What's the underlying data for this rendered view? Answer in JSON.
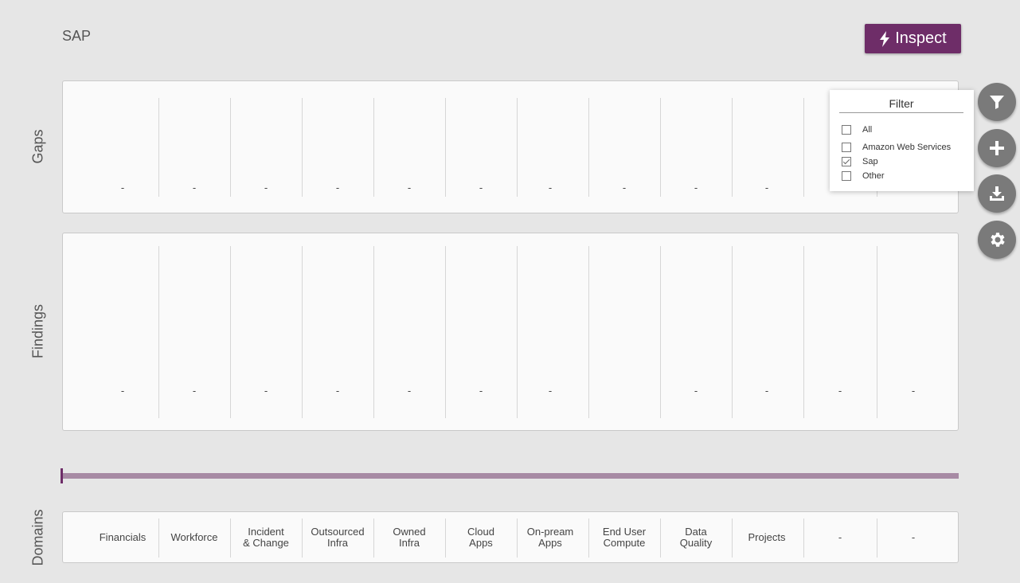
{
  "page": {
    "title": "SAP"
  },
  "toolbar": {
    "inspect_label": "Inspect",
    "inspect_icon": "bolt-icon"
  },
  "labels": {
    "gaps": "Gaps",
    "findings": "Findings",
    "domains": "Domains"
  },
  "gaps": [
    "-",
    "-",
    "-",
    "-",
    "-",
    "-",
    "-",
    "-",
    "-",
    "-"
  ],
  "findings": [
    "-",
    "-",
    "-",
    "-",
    "-",
    "-",
    "-",
    "",
    "-",
    "-",
    "-",
    "-"
  ],
  "domains": [
    "Financials",
    "Workforce",
    "Incident\n& Change",
    "Outsourced\nInfra",
    "Owned\nInfra",
    "Cloud\nApps",
    "On-pream\nApps",
    "End User\nCompute",
    "Data\nQuality",
    "Projects",
    "-",
    "-"
  ],
  "filter": {
    "title": "Filter",
    "options": [
      {
        "label": "All",
        "checked": false
      },
      {
        "label": "Amazon Web Services",
        "checked": false
      },
      {
        "label": "Sap",
        "checked": true
      },
      {
        "label": "Other",
        "checked": false
      }
    ]
  },
  "side_actions": [
    "filter-icon",
    "plus-icon",
    "download-icon",
    "gear-icon"
  ],
  "colors": {
    "accent": "#6e2d68",
    "timeline": "#a78aa4",
    "fab": "#7a7a7a",
    "background": "#e6e6e6"
  }
}
